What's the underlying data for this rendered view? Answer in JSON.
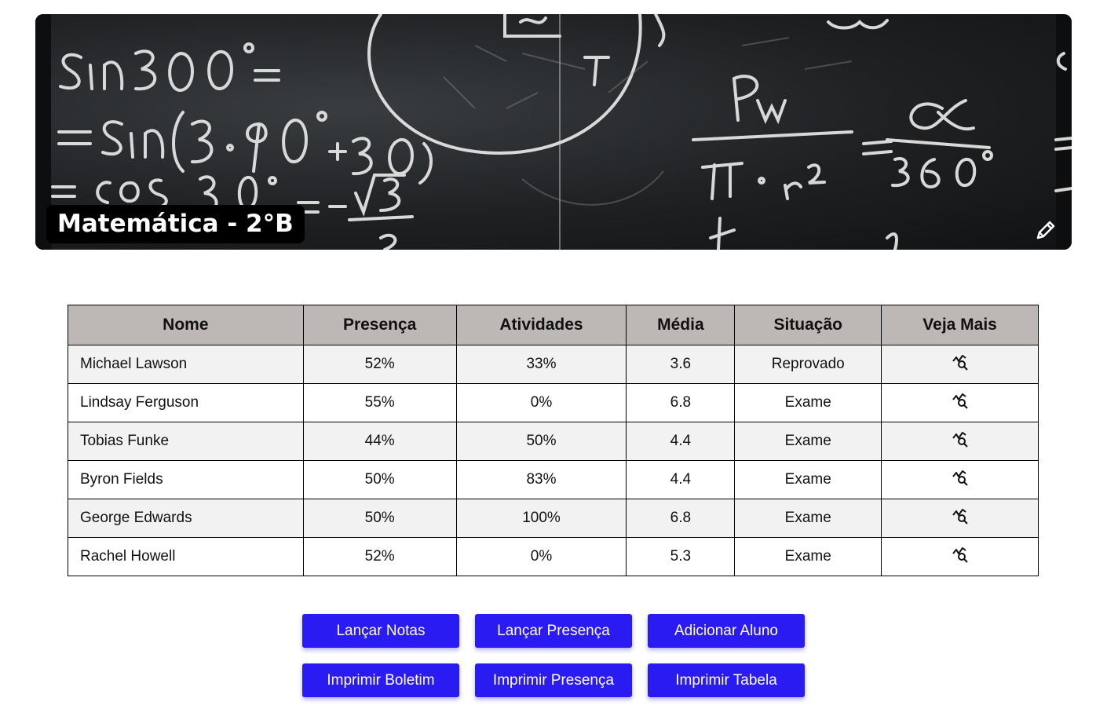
{
  "banner": {
    "title": "Matemática - 2°B",
    "edit_icon": "pencil-icon"
  },
  "table": {
    "headers": [
      "Nome",
      "Presença",
      "Atividades",
      "Média",
      "Situação",
      "Veja Mais"
    ],
    "rows": [
      {
        "name": "Michael Lawson",
        "presenca": "52%",
        "atividades": "33%",
        "media": "3.6",
        "situacao": "Reprovado"
      },
      {
        "name": "Lindsay Ferguson",
        "presenca": "55%",
        "atividades": "0%",
        "media": "6.8",
        "situacao": "Exame"
      },
      {
        "name": "Tobias Funke",
        "presenca": "44%",
        "atividades": "50%",
        "media": "4.4",
        "situacao": "Exame"
      },
      {
        "name": "Byron Fields",
        "presenca": "50%",
        "atividades": "83%",
        "media": "4.4",
        "situacao": "Exame"
      },
      {
        "name": "George Edwards",
        "presenca": "50%",
        "atividades": "100%",
        "media": "6.8",
        "situacao": "Exame"
      },
      {
        "name": "Rachel Howell",
        "presenca": "52%",
        "atividades": "0%",
        "media": "5.3",
        "situacao": "Exame"
      }
    ],
    "see_more_icon": "chart-search-icon"
  },
  "actions": {
    "lancar_notas": "Lançar Notas",
    "lancar_presenca": "Lançar Presença",
    "adicionar_aluno": "Adicionar Aluno",
    "imprimir_boletim": "Imprimir Boletim",
    "imprimir_presenca": "Imprimir Presença",
    "imprimir_tabela": "Imprimir Tabela"
  },
  "colors": {
    "primary_button": "#2a1bf2",
    "header_bg": "#bdb8b6",
    "row_alt": "#f2f2f2"
  }
}
